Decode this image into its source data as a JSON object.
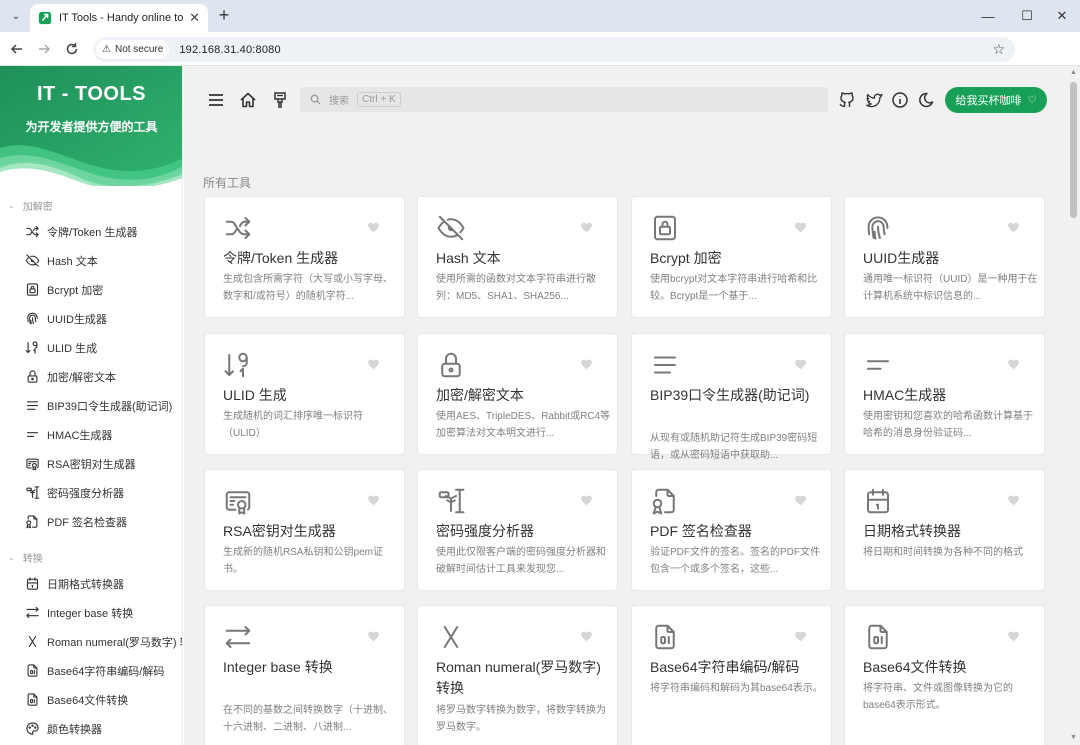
{
  "browser": {
    "tab_title": "IT Tools - Handy online tools",
    "address": {
      "security_label": "Not secure",
      "url": "192.168.31.40:8080"
    }
  },
  "sidebar": {
    "brand_title": "IT - TOOLS",
    "brand_subtitle": "为开发者提供方便的工具",
    "groups": [
      {
        "label": "加解密",
        "items": [
          {
            "label": "令牌/Token 生成器",
            "icon": "shuffle-icon"
          },
          {
            "label": "Hash 文本",
            "icon": "eye-off-icon"
          },
          {
            "label": "Bcrypt 加密",
            "icon": "lock-square-icon"
          },
          {
            "label": "UUID生成器",
            "icon": "fingerprint-icon"
          },
          {
            "label": "ULID 生成",
            "icon": "sort-numeric-icon"
          },
          {
            "label": "加密/解密文本",
            "icon": "lock-icon"
          },
          {
            "label": "BIP39口令生成器(助记词)",
            "icon": "lines-icon"
          },
          {
            "label": "HMAC生成器",
            "icon": "short-lines-icon"
          },
          {
            "label": "RSA密钥对生成器",
            "icon": "certificate-icon"
          },
          {
            "label": "密码强度分析器",
            "icon": "password-icon"
          },
          {
            "label": "PDF 签名检查器",
            "icon": "file-certificate-icon"
          }
        ]
      },
      {
        "label": "转换",
        "items": [
          {
            "label": "日期格式转换器",
            "icon": "calendar-icon"
          },
          {
            "label": "Integer base 转换",
            "icon": "arrows-left-right-icon"
          },
          {
            "label": "Roman numeral(罗马数字) 转换",
            "icon": "letter-x-icon"
          },
          {
            "label": "Base64字符串编码/解码",
            "icon": "file-digit-icon"
          },
          {
            "label": "Base64文件转换",
            "icon": "file-digit-icon"
          },
          {
            "label": "颜色转换器",
            "icon": "palette-icon"
          }
        ]
      }
    ]
  },
  "main": {
    "search": {
      "placeholder": "搜索",
      "shortcut": "Ctrl + K"
    },
    "coffee_button": "给我买杯咖啡",
    "section_title": "所有工具",
    "tools": [
      {
        "title": "令牌/Token 生成器",
        "desc": "生成包含所需字符（大写或小写字母、数字和/或符号）的随机字符...",
        "icon": "shuffle-icon"
      },
      {
        "title": "Hash 文本",
        "desc": "使用所需的函数对文本字符串进行散列：MD5、SHA1、SHA256...",
        "icon": "eye-off-icon"
      },
      {
        "title": "Bcrypt 加密",
        "desc": "使用bcrypt对文本字符串进行哈希和比较。Bcrypt是一个基于...",
        "icon": "lock-square-icon"
      },
      {
        "title": "UUID生成器",
        "desc": "通用唯一标识符（UUID）是一种用于在计算机系统中标识信息的...",
        "icon": "fingerprint-icon"
      },
      {
        "title": "ULID 生成",
        "desc": "生成随机的词汇排序唯一标识符（ULID）",
        "icon": "sort-numeric-icon"
      },
      {
        "title": "加密/解密文本",
        "desc": "使用AES、TripleDES、Rabbit或RC4等加密算法对文本明文进行...",
        "icon": "lock-icon"
      },
      {
        "title": "BIP39口令生成器(助记词)",
        "desc": "从现有或随机助记符生成BIP39密码短语，或从密码短语中获取助...",
        "icon": "lines-icon"
      },
      {
        "title": "HMAC生成器",
        "desc": "使用密钥和您喜欢的哈希函数计算基于哈希的消息身份验证码...",
        "icon": "short-lines-icon"
      },
      {
        "title": "RSA密钥对生成器",
        "desc": "生成新的随机RSA私钥和公钥pem证书。",
        "icon": "certificate-icon"
      },
      {
        "title": "密码强度分析器",
        "desc": "使用此仅限客户端的密码强度分析器和破解时间估计工具来发现您...",
        "icon": "password-icon"
      },
      {
        "title": "PDF 签名检查器",
        "desc": "验证PDF文件的签名。签名的PDF文件包含一个或多个签名，这些...",
        "icon": "file-certificate-icon"
      },
      {
        "title": "日期格式转换器",
        "desc": "将日期和时间转换为各种不同的格式",
        "icon": "calendar-icon"
      },
      {
        "title": "Integer base 转换",
        "desc": "在不同的基数之间转换数字（十进制、十六进制、二进制、八进制...",
        "icon": "arrows-left-right-icon"
      },
      {
        "title": "Roman numeral(罗马数字) 转换",
        "desc": "将罗马数字转换为数字，将数字转换为罗马数字。",
        "icon": "letter-x-icon"
      },
      {
        "title": "Base64字符串编码/解码",
        "desc": "将字符串编码和解码为其base64表示。",
        "icon": "file-digit-icon"
      },
      {
        "title": "Base64文件转换",
        "desc": "将字符串、文件或图像转换为它的base64表示形式。",
        "icon": "file-digit-icon"
      }
    ]
  },
  "colors": {
    "accent": "#18a058",
    "brand_dark": "#1f8f5a",
    "brand_light": "#3cc47f"
  }
}
